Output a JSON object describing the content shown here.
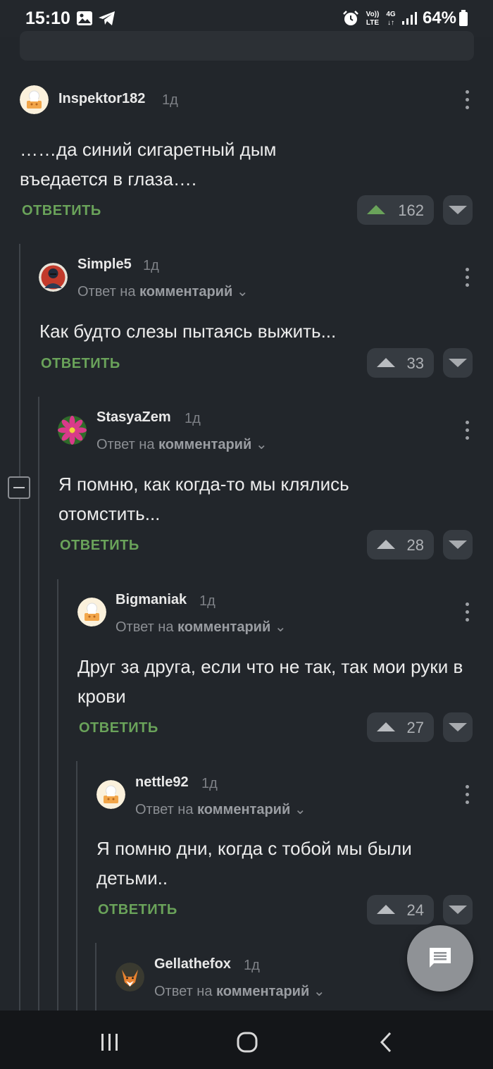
{
  "status_bar": {
    "time": "15:10",
    "battery": "64%",
    "network_top": "Vo))",
    "network_bottom": "LTE",
    "network_gen": "4G",
    "icons": [
      "gallery-icon",
      "telegram-icon",
      "alarm-icon",
      "volte-icon",
      "signal-icon",
      "battery-icon"
    ]
  },
  "reply_label": "ОТВЕТИТЬ",
  "reply_to_prefix": "Ответ на",
  "reply_to_link": "комментарий",
  "comments": [
    {
      "author": "Inspektor182",
      "time": "1д",
      "text": "……да синий сигаретный дым въедается в глаза….",
      "votes": "162",
      "avatar": "cook-avatar"
    },
    {
      "author": "Simple5",
      "time": "1д",
      "text": "Как будто слезы пытаясь выжить...",
      "votes": "33",
      "avatar": "portrait-avatar"
    },
    {
      "author": "StasyaZem",
      "time": "1д",
      "text": "Я помню, как когда-то мы клялись отомстить...",
      "votes": "28",
      "avatar": "flower-avatar"
    },
    {
      "author": "Bigmaniak",
      "time": "1д",
      "text": "Друг за друга, если что не так, так мои руки в крови",
      "votes": "27",
      "avatar": "cook-avatar"
    },
    {
      "author": "nettle92",
      "time": "1д",
      "text": "Я помню дни, когда с тобой мы были детьми..",
      "votes": "24",
      "avatar": "cook-avatar"
    },
    {
      "author": "Gellathefox",
      "time": "1д",
      "avatar": "fox-avatar"
    }
  ],
  "colors": {
    "background": "#22262b",
    "accent_green": "#6aa35a",
    "upvote_active": "#6aa35a"
  }
}
